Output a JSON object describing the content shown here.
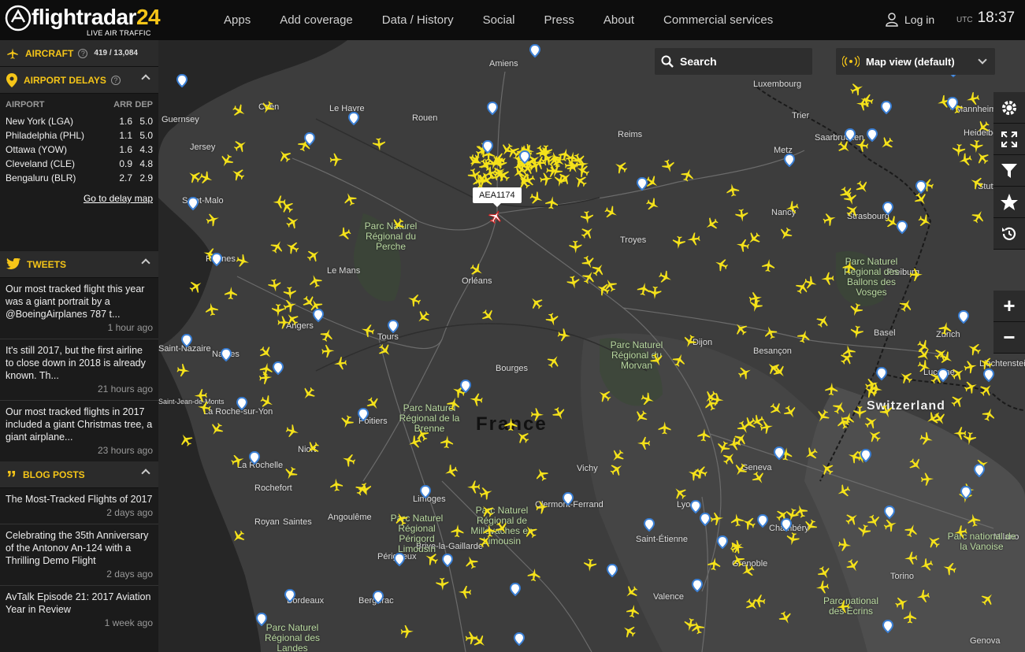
{
  "header": {
    "logo_text": "flightradar",
    "logo_number": "24",
    "tagline": "LIVE AIR TRAFFIC",
    "nav": [
      "Apps",
      "Add coverage",
      "Data / History",
      "Social",
      "Press",
      "About",
      "Commercial services"
    ],
    "login_label": "Log in",
    "utc_label": "UTC",
    "time": "18:37"
  },
  "sidebar": {
    "aircraft": {
      "label": "AIRCRAFT",
      "count": "419 / 13,084"
    },
    "delays": {
      "label": "AIRPORT DELAYS",
      "columns": [
        "AIRPORT",
        "ARR",
        "DEP"
      ],
      "rows": [
        [
          "New York (LGA)",
          "1.6",
          "5.0"
        ],
        [
          "Philadelphia (PHL)",
          "1.1",
          "5.0"
        ],
        [
          "Ottawa (YOW)",
          "1.6",
          "4.3"
        ],
        [
          "Cleveland (CLE)",
          "0.9",
          "4.8"
        ],
        [
          "Bengaluru (BLR)",
          "2.7",
          "2.9"
        ]
      ],
      "link": "Go to delay map"
    },
    "tweets": {
      "label": "TWEETS",
      "items": [
        {
          "text": "Our most tracked flight this year was a giant portrait by a @BoeingAirplanes 787 t...",
          "ago": "1 hour ago"
        },
        {
          "text": "It's still 2017, but the first airline to close down in 2018 is already known. Th...",
          "ago": "21 hours ago"
        },
        {
          "text": "Our most tracked flights in 2017 included a giant Christmas tree, a giant airplane...",
          "ago": "23 hours ago"
        }
      ]
    },
    "blog": {
      "label": "BLOG POSTS",
      "items": [
        {
          "text": "The Most-Tracked Flights of 2017",
          "ago": "2 days ago"
        },
        {
          "text": "Celebrating the 35th Anniversary of the Antonov An-124 with a Thrilling Demo Flight",
          "ago": "2 days ago"
        },
        {
          "text": "AvTalk Episode 21: 2017 Aviation Year in Review",
          "ago": "1 week ago"
        }
      ]
    }
  },
  "map": {
    "search_label": "Search",
    "mapview_label": "Map view (default)",
    "selected_flight": "AEA1174",
    "country_label": "France",
    "places": [
      "Amiens",
      "Le Havre",
      "Rouen",
      "Reims",
      "Metz",
      "Luxembourg",
      "Trier",
      "Saarbrucken",
      "Heidelberg",
      "Mannheim",
      "Stuttgart",
      "Strasbourg",
      "Nancy",
      "Troyes",
      "Dijon",
      "Besançon",
      "Basel",
      "Freiburg",
      "Zurich",
      "Lucerne",
      "Liechtenstein",
      "Switzerland",
      "Geneva",
      "Lyon",
      "Grenoble",
      "Valence",
      "Chambéry",
      "Torino",
      "Milano",
      "Genova",
      "Rennes",
      "Le Mans",
      "Angers",
      "Nantes",
      "Saint-Nazaire",
      "Tours",
      "Orléans",
      "Bourges",
      "Poitiers",
      "Niort",
      "La Rochelle",
      "Rochefort",
      "Royan",
      "Saintes",
      "Angoulême",
      "Limoges",
      "Périgueux",
      "Brive-la-Gaillarde",
      "Bergerac",
      "Bordeaux",
      "Clermont-Ferrand",
      "Vichy",
      "Saint-Étienne",
      "Caen",
      "Jersey",
      "Guernsey",
      "Saint-Malo",
      "La Roche-sur-Yon",
      "Saint-Jean-de-Monts"
    ],
    "parks": [
      "Parc Naturel Régional du Perche",
      "Parc Naturel Régional du Morvan",
      "Parc Naturel Régional de la Brenne",
      "Parc Naturel Régional Périgord Limousin",
      "Parc Naturel Régional de Millevaches en Limousin",
      "Parc Naturel Régional des Ballons des Vosges",
      "Parc national de la Vanoise",
      "Parc national des Écrins",
      "Parc Naturel Régional des Landes"
    ]
  },
  "colors": {
    "plane": "#f5e21a",
    "pin": "#3a7fd5",
    "accent": "#f5c518",
    "map_bg": "#3d3d3d"
  },
  "icons": [
    "globe-logo-icon",
    "plane-icon",
    "pin-icon",
    "help-icon",
    "twitter-icon",
    "quote-icon",
    "search-icon",
    "radar-icon",
    "gear-icon",
    "fullscreen-icon",
    "filter-icon",
    "star-icon",
    "history-icon",
    "user-icon"
  ]
}
